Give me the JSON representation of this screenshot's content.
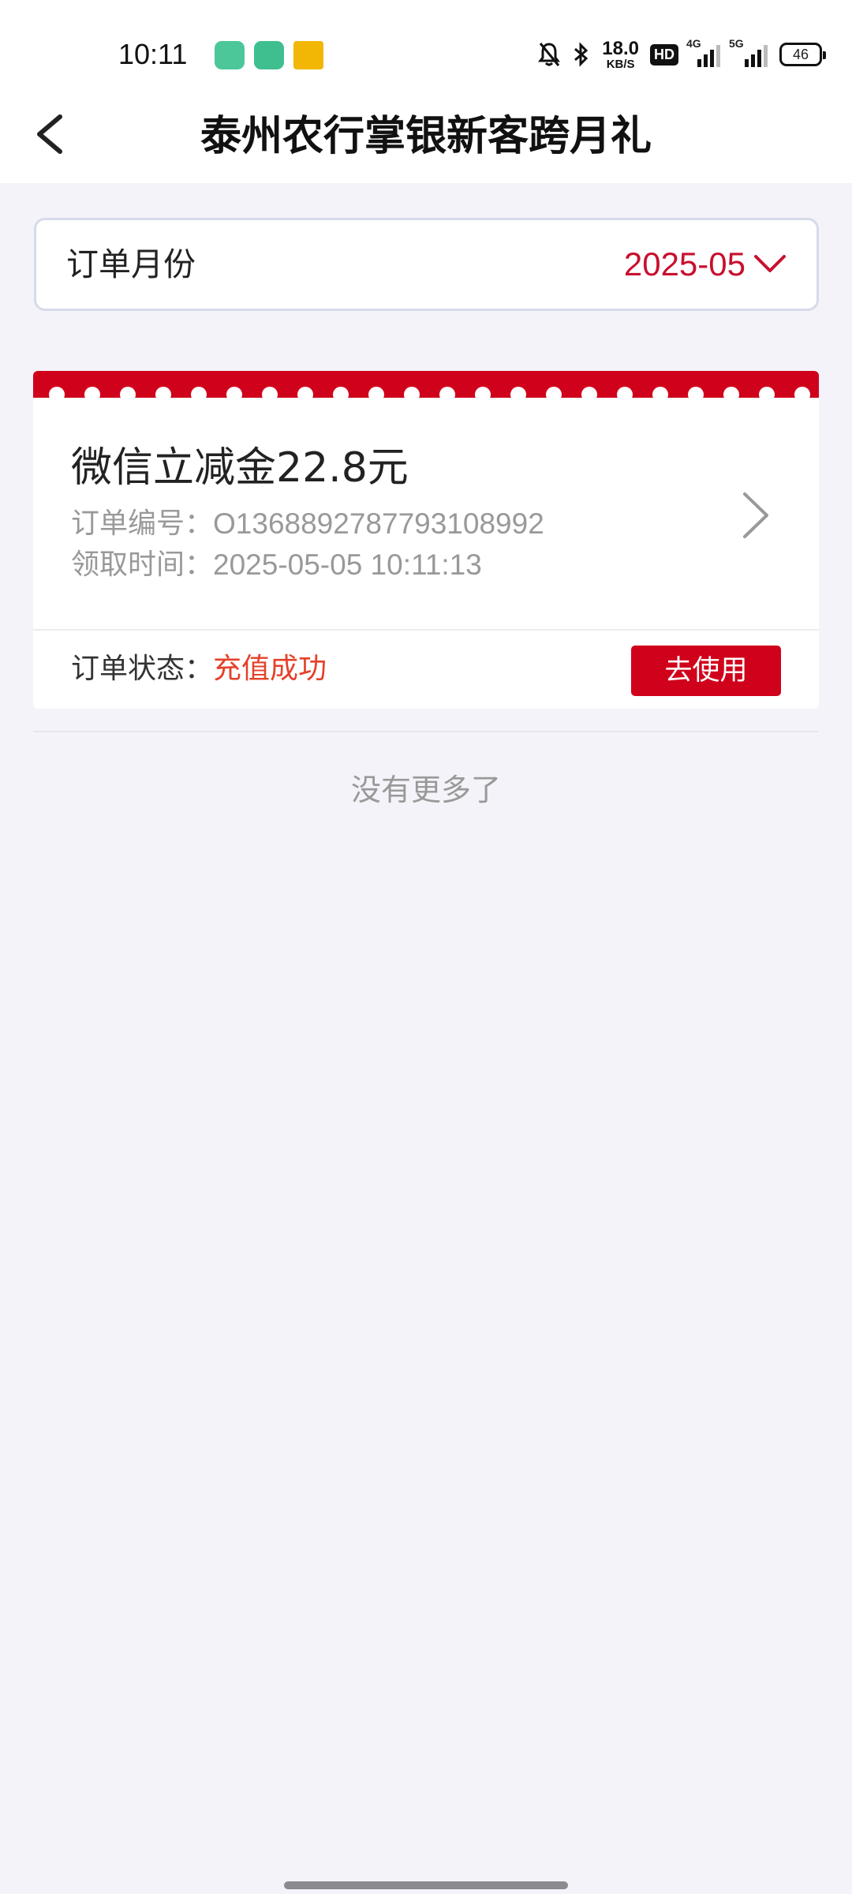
{
  "status_bar": {
    "time": "10:11",
    "net_speed_value": "18.0",
    "net_speed_unit": "KB/S",
    "hd_badge": "HD",
    "sim1_label": "4G",
    "sim2_label": "5G",
    "battery": "46"
  },
  "navbar": {
    "title": "泰州农行掌银新客跨月礼",
    "back_icon": "chevron-left-icon"
  },
  "month_filter": {
    "label": "订单月份",
    "value": "2025-05",
    "dropdown_icon": "chevron-down-icon"
  },
  "orders": [
    {
      "title": "微信立减金22.8元",
      "order_no_label": "订单编号：",
      "order_no": "O136889278779310899​2",
      "time_label": "领取时间：",
      "time": "2025-05-05 10:11:13",
      "status_label": "订单状态：",
      "status": "充值成功",
      "action": "去使用"
    }
  ],
  "list_end_text": "没有更多了",
  "colors": {
    "accent": "#d0021b",
    "status_success": "#e4412a",
    "background": "#f3f3f9"
  }
}
